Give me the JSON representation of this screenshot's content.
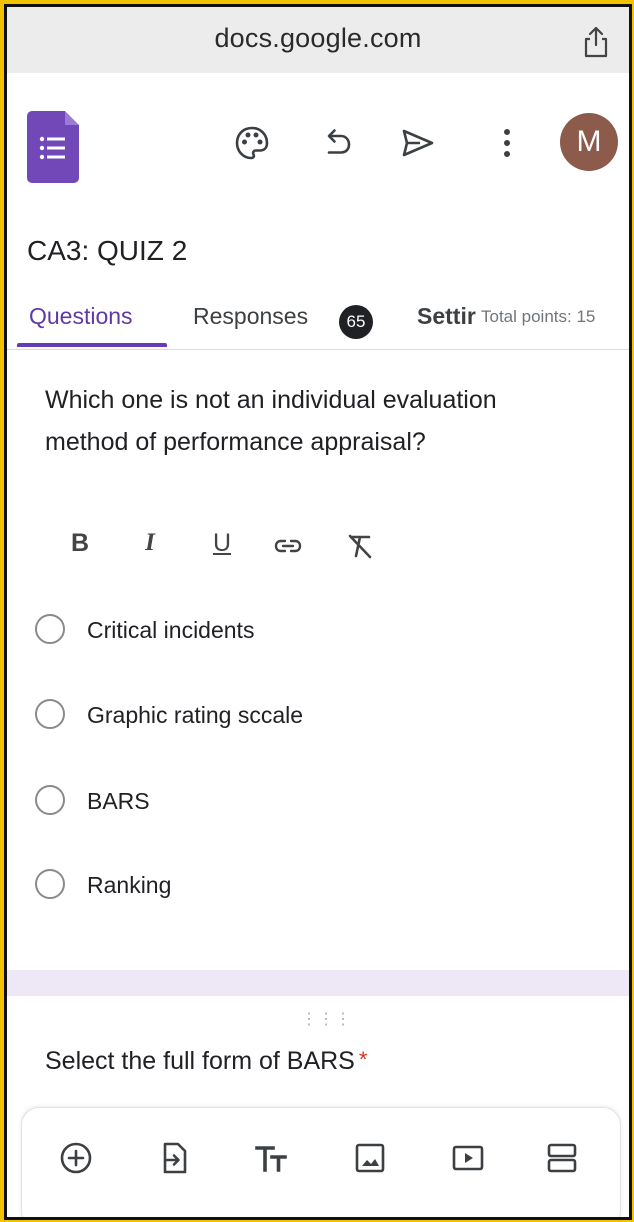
{
  "browser": {
    "url": "docs.google.com"
  },
  "appbar": {
    "avatar_initial": "M",
    "brand_color": "#673ab7"
  },
  "form": {
    "title": "CA3: QUIZ 2"
  },
  "tabs": {
    "questions": "Questions",
    "responses": "Responses",
    "responses_count": "65",
    "settings": "Settir",
    "total_points": "Total points: 15"
  },
  "question1": {
    "text": "Which one is not an individual evaluation method of performance appraisal?",
    "format": {
      "bold": "B",
      "italic": "I",
      "underline": "U"
    },
    "options": [
      {
        "label": "Critical incidents"
      },
      {
        "label": "Graphic rating sccale"
      },
      {
        "label": "BARS"
      },
      {
        "label": "Ranking"
      }
    ]
  },
  "question2": {
    "text": "Select the full form of BARS",
    "required_mark": "*"
  },
  "icons": {
    "share": "share-icon",
    "palette": "palette-icon",
    "undo": "undo-icon",
    "send": "send-icon",
    "more": "more-vert-icon",
    "add": "add-question-icon",
    "import": "import-questions-icon",
    "title": "add-title-icon",
    "image": "add-image-icon",
    "video": "add-video-icon",
    "section": "add-section-icon"
  }
}
